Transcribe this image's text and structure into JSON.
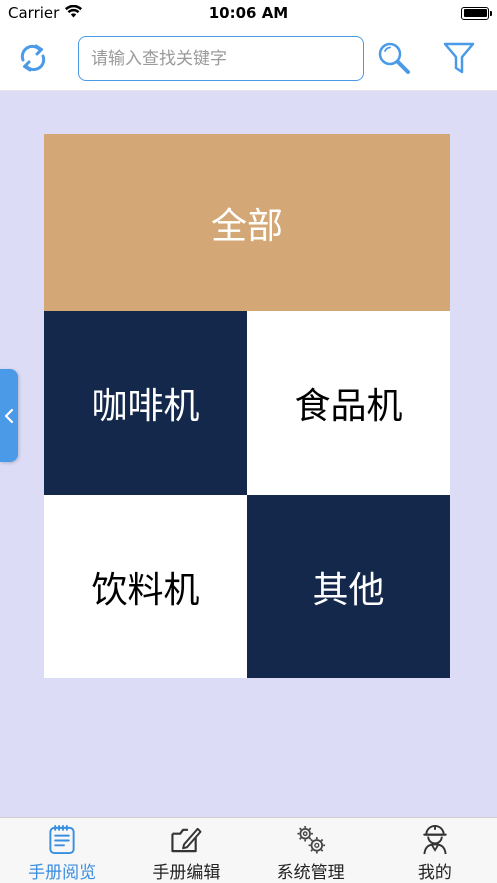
{
  "status_bar": {
    "carrier": "Carrier",
    "time": "10:06 AM"
  },
  "nav_bar": {
    "search_placeholder": "请输入查找关键字",
    "search_value": ""
  },
  "categories": {
    "all": "全部",
    "coffee": "咖啡机",
    "food": "食品机",
    "drink": "饮料机",
    "other": "其他"
  },
  "tab_bar": {
    "items": [
      {
        "label": "手册阅览",
        "icon": "document-icon",
        "active": true
      },
      {
        "label": "手册编辑",
        "icon": "edit-folder-icon",
        "active": false
      },
      {
        "label": "系统管理",
        "icon": "gears-icon",
        "active": false
      },
      {
        "label": "我的",
        "icon": "worker-icon",
        "active": false
      }
    ]
  },
  "colors": {
    "accent": "#4a9ae8",
    "background": "#dcdcf7",
    "tile_tan": "#d4a876",
    "tile_navy": "#14284b"
  }
}
